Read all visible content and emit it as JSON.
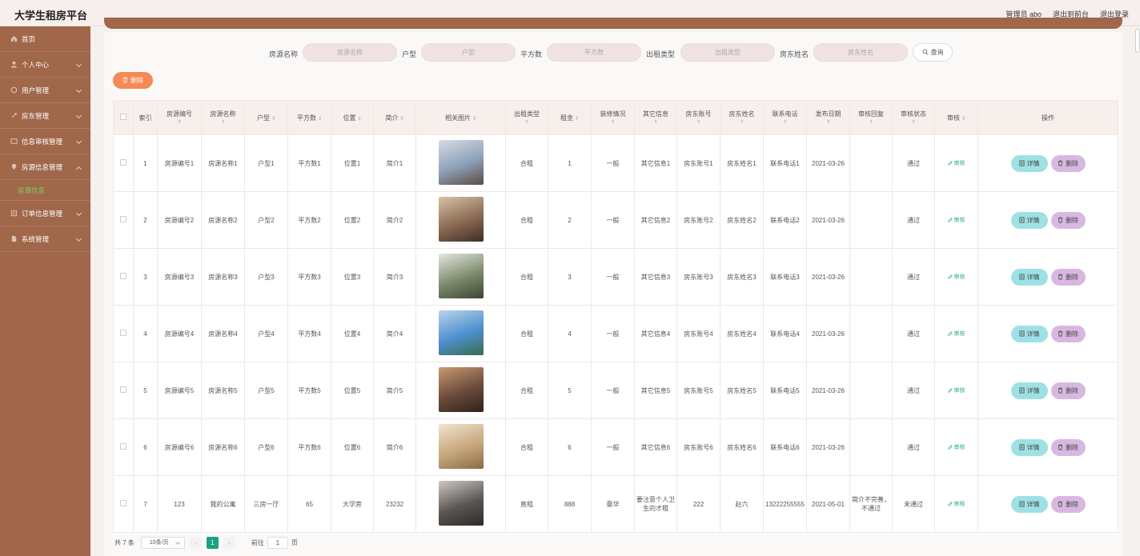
{
  "app": {
    "title": "大学生租房平台"
  },
  "header": {
    "admin_label": "管理员 abo",
    "back_front_label": "退出到前台",
    "logout_label": "退出登录"
  },
  "sidebar": {
    "items": [
      {
        "label": "首页",
        "icon": "home-icon"
      },
      {
        "label": "个人中心",
        "icon": "user-icon"
      },
      {
        "label": "用户管理",
        "icon": "users-icon"
      },
      {
        "label": "房东管理",
        "icon": "landlord-icon"
      },
      {
        "label": "信息审核管理",
        "icon": "audit-icon"
      },
      {
        "label": "房源信息管理",
        "icon": "house-icon"
      },
      {
        "label": "订单信息管理",
        "icon": "order-icon"
      },
      {
        "label": "系统管理",
        "icon": "system-icon"
      }
    ],
    "active_sub_item": "房源信息"
  },
  "search": {
    "fields": [
      {
        "label": "房源名称",
        "placeholder": "房源名称"
      },
      {
        "label": "户型",
        "placeholder": "户型"
      },
      {
        "label": "平方数",
        "placeholder": "平方数"
      },
      {
        "label": "出租类型",
        "placeholder": "出租类型"
      },
      {
        "label": "房东姓名",
        "placeholder": "房东姓名"
      }
    ],
    "button_label": "查询"
  },
  "toolbar": {
    "delete_label": "删除"
  },
  "table": {
    "headers": [
      "索引",
      "房源编号",
      "房源名称",
      "户型",
      "平方数",
      "位置",
      "简介",
      "相关图片",
      "出租类型",
      "租金",
      "装修情况",
      "其它信息",
      "房东账号",
      "房东姓名",
      "联系电话",
      "发布日期",
      "审核回复",
      "审核状态",
      "审核",
      "操作"
    ],
    "audit_label": "审核",
    "detail_label": "详情",
    "row_delete_label": "删除",
    "rows": [
      {
        "index": "1",
        "code": "房源编号1",
        "name": "房源名称1",
        "layout": "户型1",
        "area": "平方数1",
        "location": "位置1",
        "intro": "简介1",
        "rent_type": "合租",
        "rent": "1",
        "decor": "一般",
        "other": "其它信息1",
        "account": "房东账号1",
        "owner": "房东姓名1",
        "phone": "联系电话1",
        "date": "2021-03-26",
        "reply": "",
        "status": "通过"
      },
      {
        "index": "2",
        "code": "房源编号2",
        "name": "房源名称2",
        "layout": "户型2",
        "area": "平方数2",
        "location": "位置2",
        "intro": "简介2",
        "rent_type": "合租",
        "rent": "2",
        "decor": "一般",
        "other": "其它信息2",
        "account": "房东账号2",
        "owner": "房东姓名2",
        "phone": "联系电话2",
        "date": "2021-03-26",
        "reply": "",
        "status": "通过"
      },
      {
        "index": "3",
        "code": "房源编号3",
        "name": "房源名称3",
        "layout": "户型3",
        "area": "平方数3",
        "location": "位置3",
        "intro": "简介3",
        "rent_type": "合租",
        "rent": "3",
        "decor": "一般",
        "other": "其它信息3",
        "account": "房东账号3",
        "owner": "房东姓名3",
        "phone": "联系电话3",
        "date": "2021-03-26",
        "reply": "",
        "status": "通过"
      },
      {
        "index": "4",
        "code": "房源编号4",
        "name": "房源名称4",
        "layout": "户型4",
        "area": "平方数4",
        "location": "位置4",
        "intro": "简介4",
        "rent_type": "合租",
        "rent": "4",
        "decor": "一般",
        "other": "其它信息4",
        "account": "房东账号4",
        "owner": "房东姓名4",
        "phone": "联系电话4",
        "date": "2021-03-26",
        "reply": "",
        "status": "通过"
      },
      {
        "index": "5",
        "code": "房源编号5",
        "name": "房源名称5",
        "layout": "户型5",
        "area": "平方数5",
        "location": "位置5",
        "intro": "简介5",
        "rent_type": "合租",
        "rent": "5",
        "decor": "一般",
        "other": "其它信息5",
        "account": "房东账号5",
        "owner": "房东姓名5",
        "phone": "联系电话5",
        "date": "2021-03-26",
        "reply": "",
        "status": "通过"
      },
      {
        "index": "6",
        "code": "房源编号6",
        "name": "房源名称6",
        "layout": "户型6",
        "area": "平方数6",
        "location": "位置6",
        "intro": "简介6",
        "rent_type": "合租",
        "rent": "6",
        "decor": "一般",
        "other": "其它信息6",
        "account": "房东账号6",
        "owner": "房东姓名6",
        "phone": "联系电话6",
        "date": "2021-03-26",
        "reply": "",
        "status": "通过"
      },
      {
        "index": "7",
        "code": "123",
        "name": "我的公寓",
        "layout": "三房一厅",
        "area": "65",
        "location": "大学旁",
        "intro": "23232",
        "rent_type": "直租",
        "rent": "888",
        "decor": "豪华",
        "other": "要注意个人卫生的才租",
        "account": "222",
        "owner": "赵六",
        "phone": "13222255555",
        "date": "2021-05-01",
        "reply": "简介不完善，不通过",
        "status": "未通过"
      }
    ]
  },
  "pagination": {
    "total_label": "共 7 条",
    "page_size": "10条/页",
    "current_page": "1",
    "goto_label": "前往",
    "goto_value": "1",
    "page_unit": "页"
  },
  "colors": {
    "sidebar": "#a0674a",
    "accent_green": "#1aa383",
    "delete_orange": "#f48a55",
    "detail_cyan": "#9ee1e4",
    "row_delete_purple": "#d8b8e0"
  }
}
